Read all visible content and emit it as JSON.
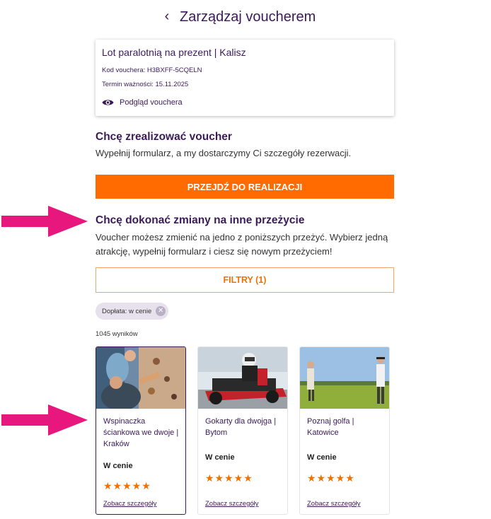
{
  "header": {
    "back_icon": "chevron-left-icon",
    "title": "Zarządzaj voucherem"
  },
  "voucher": {
    "name": "Lot paralotnią na prezent | Kalisz",
    "code": "Kod vouchera: H3BXFF-5CQELN",
    "expiry": "Termin ważności: 15.11.2025",
    "preview_icon": "eye-icon",
    "preview_label": "Podgląd vouchera"
  },
  "realize": {
    "heading": "Chcę zrealizować voucher",
    "text": "Wypełnij formularz, a my dostarczymy Ci szczegóły rezerwacji.",
    "button": "PRZEJDŹ DO REALIZACJI"
  },
  "exchange": {
    "heading": "Chcę dokonać zmiany na inne przeżycie",
    "text_line1": "Voucher możesz zmienić na jedno z poniższych przeżyć. Wybierz jedną",
    "text_line2": "atrakcję, wypełnij formularz i ciesz się nowym przeżyciem!",
    "filters_button": "FILTRY (1)",
    "chip_label": "Dopłata: w cenie",
    "chip_close_icon": "close-icon",
    "results_count": "1045 wyników"
  },
  "cards": [
    {
      "name_line1": "Wspinaczka",
      "name_line2": "ściankowa we dwoje |",
      "name_line3": "Kraków",
      "price": "W cenie",
      "rating": 5,
      "stars": "★★★★★",
      "link": "Zobacz szczegóły"
    },
    {
      "name_line1": "Gokarty dla dwojga |",
      "name_line2": "Bytom",
      "price": "W cenie",
      "rating": 5,
      "stars": "★★★★★",
      "link": "Zobacz szczegóły"
    },
    {
      "name_line1": "Poznaj golfa |",
      "name_line2": "Katowice",
      "price": "W cenie",
      "rating": 5,
      "stars": "★★★★★",
      "link": "Zobacz szczegóły"
    }
  ],
  "colors": {
    "brand_purple": "#3b1a5a",
    "accent_orange": "#ff6b00",
    "annotation_pink": "#e8177d"
  }
}
